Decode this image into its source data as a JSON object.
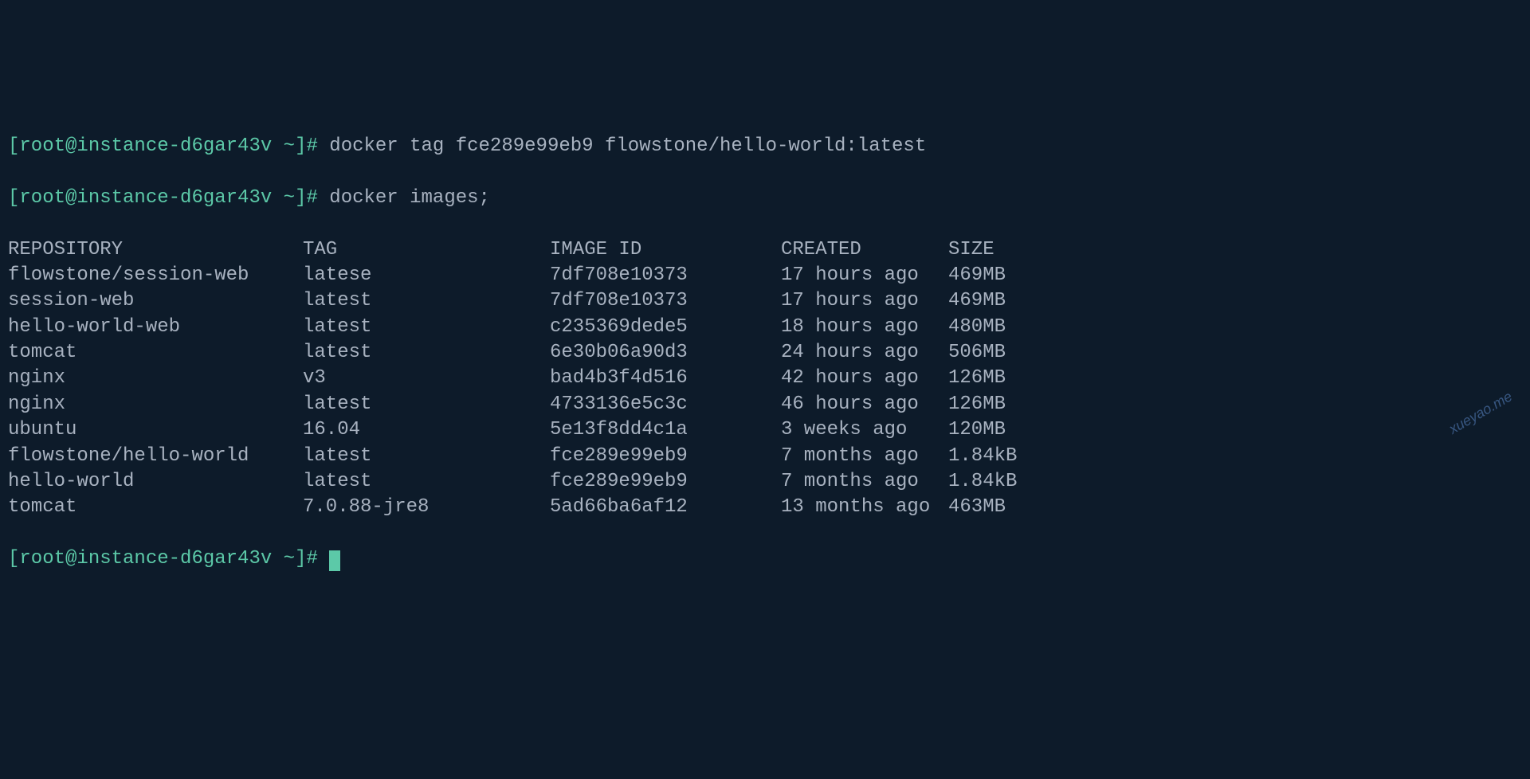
{
  "prompts": [
    {
      "user_host": "root@instance-d6gar43v",
      "cwd": "~",
      "symbol": "#",
      "command": "docker tag fce289e99eb9 flowstone/hello-world:latest"
    },
    {
      "user_host": "root@instance-d6gar43v",
      "cwd": "~",
      "symbol": "#",
      "command": "docker images;"
    }
  ],
  "table": {
    "headers": {
      "repository": "REPOSITORY",
      "tag": "TAG",
      "image_id": "IMAGE ID",
      "created": "CREATED",
      "size": "SIZE"
    },
    "rows": [
      {
        "repository": "flowstone/session-web",
        "tag": "latese",
        "image_id": "7df708e10373",
        "created": "17 hours ago",
        "size": "469MB"
      },
      {
        "repository": "session-web",
        "tag": "latest",
        "image_id": "7df708e10373",
        "created": "17 hours ago",
        "size": "469MB"
      },
      {
        "repository": "hello-world-web",
        "tag": "latest",
        "image_id": "c235369dede5",
        "created": "18 hours ago",
        "size": "480MB"
      },
      {
        "repository": "tomcat",
        "tag": "latest",
        "image_id": "6e30b06a90d3",
        "created": "24 hours ago",
        "size": "506MB"
      },
      {
        "repository": "nginx",
        "tag": "v3",
        "image_id": "bad4b3f4d516",
        "created": "42 hours ago",
        "size": "126MB"
      },
      {
        "repository": "nginx",
        "tag": "latest",
        "image_id": "4733136e5c3c",
        "created": "46 hours ago",
        "size": "126MB"
      },
      {
        "repository": "ubuntu",
        "tag": "16.04",
        "image_id": "5e13f8dd4c1a",
        "created": "3 weeks ago",
        "size": "120MB"
      },
      {
        "repository": "flowstone/hello-world",
        "tag": "latest",
        "image_id": "fce289e99eb9",
        "created": "7 months ago",
        "size": "1.84kB"
      },
      {
        "repository": "hello-world",
        "tag": "latest",
        "image_id": "fce289e99eb9",
        "created": "7 months ago",
        "size": "1.84kB"
      },
      {
        "repository": "tomcat",
        "tag": "7.0.88-jre8",
        "image_id": "5ad66ba6af12",
        "created": "13 months ago",
        "size": "463MB"
      }
    ]
  },
  "final_prompt": {
    "user_host": "root@instance-d6gar43v",
    "cwd": "~",
    "symbol": "#"
  },
  "watermark": "xueyao.me"
}
